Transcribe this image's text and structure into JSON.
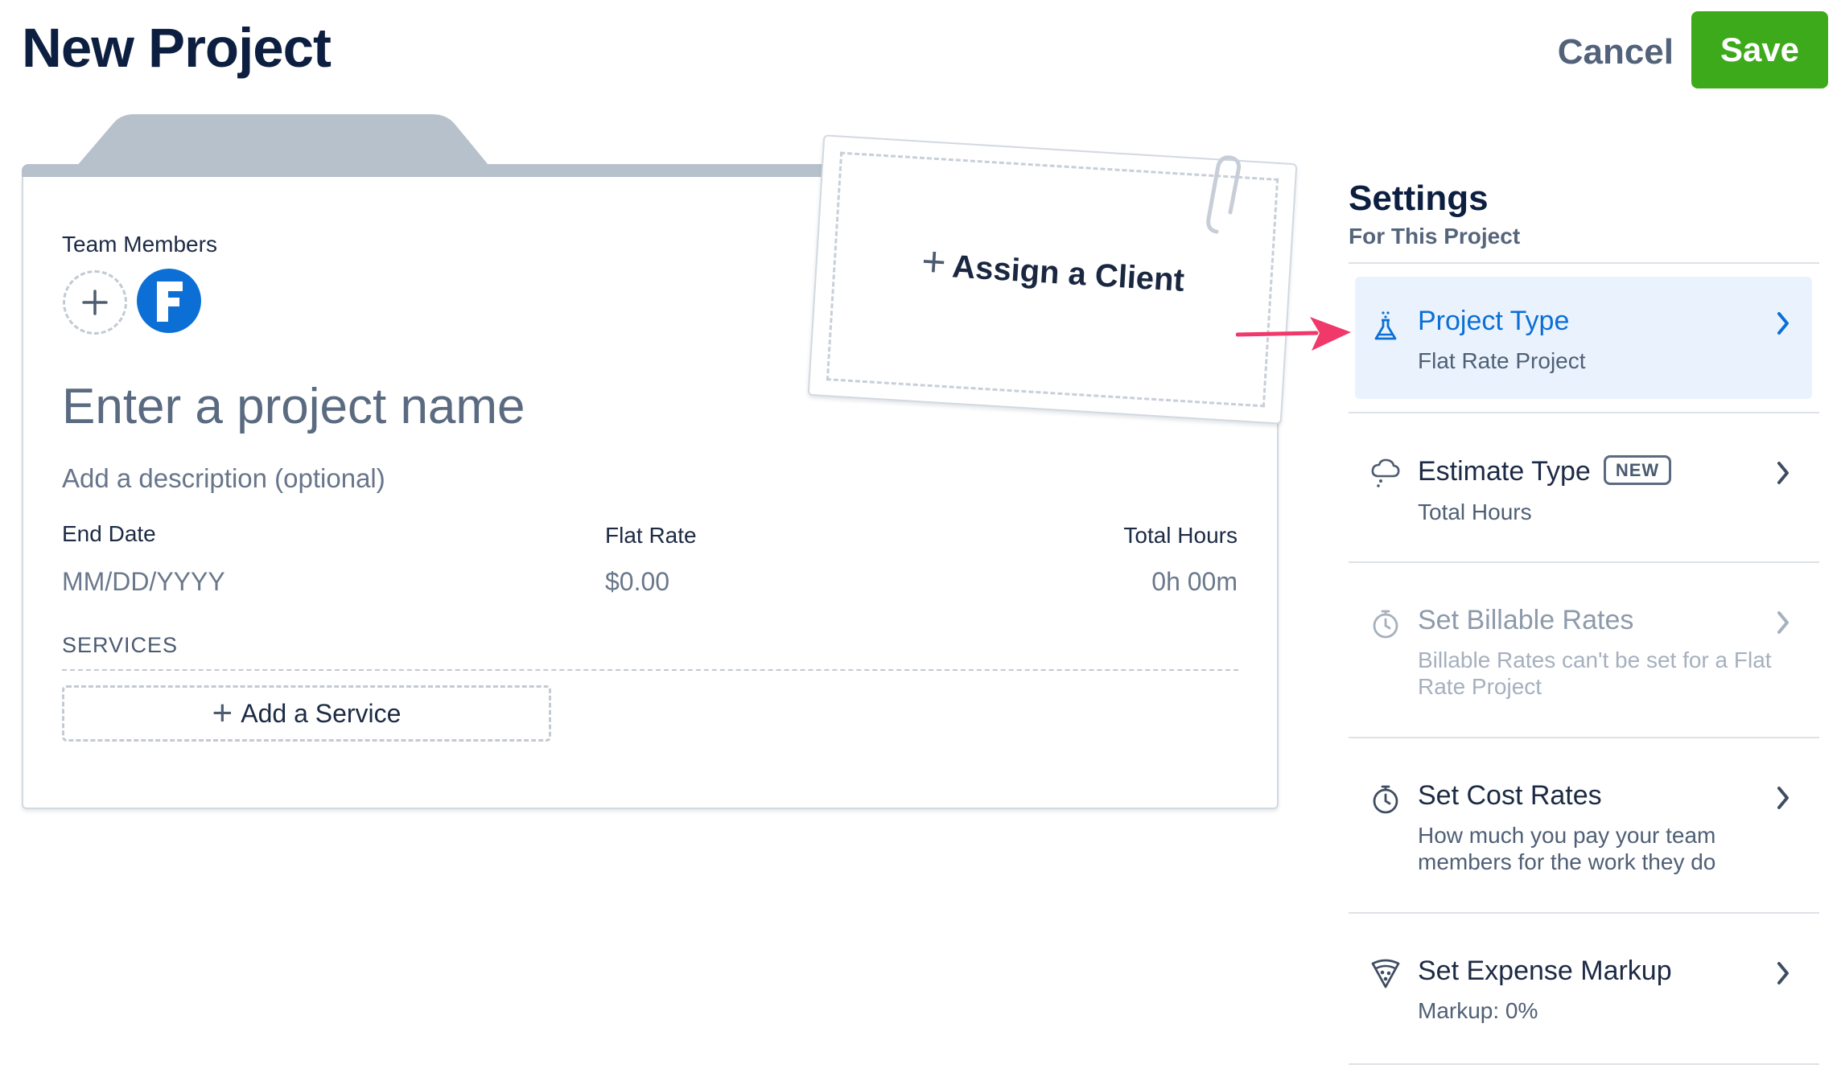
{
  "header": {
    "title": "New Project",
    "cancel_label": "Cancel",
    "save_label": "Save"
  },
  "project": {
    "team_members_label": "Team Members",
    "avatar_letter": "F",
    "name_placeholder": "Enter a project name",
    "description_placeholder": "Add a description (optional)",
    "end_date_label": "End Date",
    "end_date_placeholder": "MM/DD/YYYY",
    "flat_rate_label": "Flat Rate",
    "flat_rate_value": "$0.00",
    "total_hours_label": "Total Hours",
    "total_hours_value": "0h 00m",
    "services_label": "SERVICES",
    "add_service_label": "Add a Service",
    "assign_client_label": "Assign a Client"
  },
  "settings": {
    "title": "Settings",
    "subtitle": "For This Project",
    "items": [
      {
        "title": "Project Type",
        "subtitle": "Flat Rate Project",
        "icon": "flask-icon",
        "state": "active"
      },
      {
        "title": "Estimate Type",
        "badge": "NEW",
        "subtitle": "Total Hours",
        "icon": "cloud-icon",
        "state": "normal"
      },
      {
        "title": "Set Billable Rates",
        "subtitle": "Billable Rates can't be set for a Flat Rate Project",
        "icon": "stopwatch-icon",
        "state": "disabled"
      },
      {
        "title": "Set Cost Rates",
        "subtitle": "How much you pay your team members for the work they do",
        "icon": "stopwatch-icon",
        "state": "normal"
      },
      {
        "title": "Set Expense Markup",
        "subtitle": "Markup: 0%",
        "icon": "pizza-icon",
        "state": "normal"
      }
    ]
  },
  "colors": {
    "accent_blue": "#0b6fd6",
    "save_green": "#3daa1c",
    "annotation_pink": "#f0386b",
    "title_navy": "#0d1f40"
  }
}
